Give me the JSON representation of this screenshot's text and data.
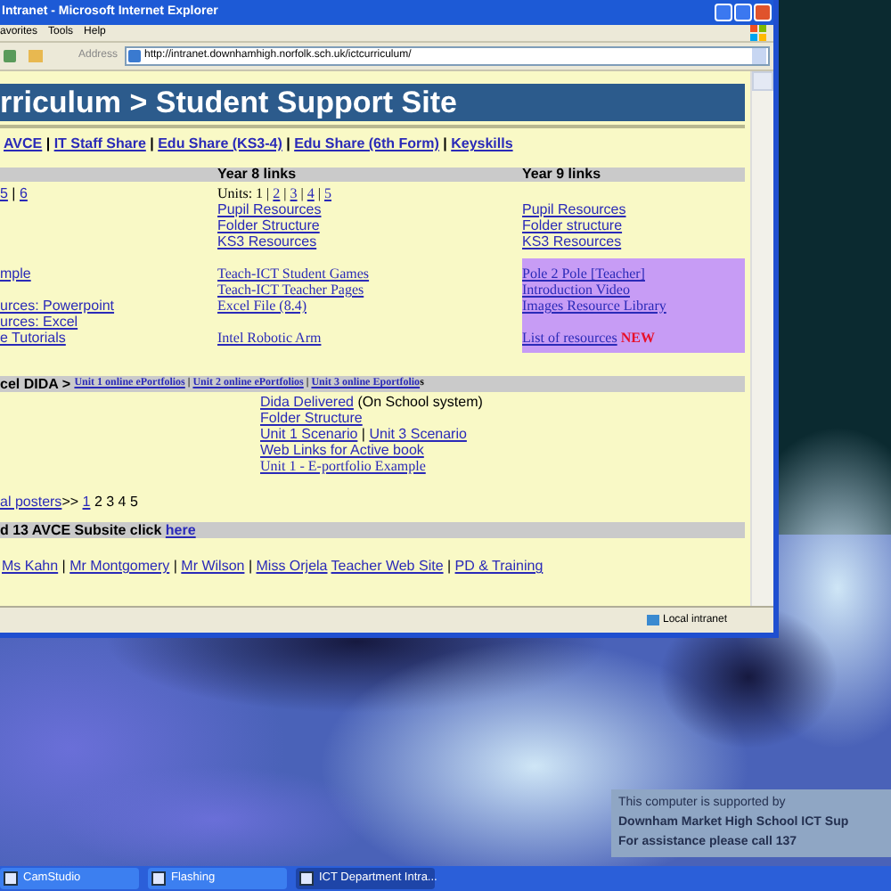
{
  "window": {
    "title": "Intranet - Microsoft Internet Explorer",
    "menu": [
      "avorites",
      "Tools",
      "Help"
    ],
    "address": {
      "label": "Address",
      "url": "http://intranet.downhamhigh.norfolk.sch.uk/ictcurriculum/"
    },
    "status_bar": "Local intranet"
  },
  "page": {
    "banner": "rriculum > Student Support Site",
    "nav": [
      {
        "kind": "link",
        "text": "AVCE"
      },
      {
        "kind": "text",
        "text": " | "
      },
      {
        "kind": "link",
        "text": "IT Staff Share"
      },
      {
        "kind": "text",
        "text": " | "
      },
      {
        "kind": "link",
        "text": "Edu Share (KS3-4)"
      },
      {
        "kind": "text",
        "text": " | "
      },
      {
        "kind": "link",
        "text": "Edu Share (6th Form)"
      },
      {
        "kind": "text",
        "text": " | "
      },
      {
        "kind": "link",
        "text": "Keyskills"
      }
    ],
    "year_links": {
      "headers": [
        "Year 8 links",
        "Year 9 links"
      ],
      "blocks": [
        {
          "highlight": false,
          "rows": [
            {
              "column_1": [
                {
                  "kind": "link",
                  "text": "5"
                },
                {
                  "kind": "text",
                  "text": " | "
                },
                {
                  "kind": "link",
                  "text": "6"
                }
              ],
              "year_8": [
                {
                  "kind": "serif-text",
                  "text": "Units: 1 | "
                },
                {
                  "kind": "serif-link",
                  "text": "2"
                },
                {
                  "kind": "serif-text",
                  "text": " | "
                },
                {
                  "kind": "serif-link",
                  "text": "3"
                },
                {
                  "kind": "serif-text",
                  "text": " | "
                },
                {
                  "kind": "serif-link",
                  "text": "4"
                },
                {
                  "kind": "serif-text",
                  "text": " | "
                },
                {
                  "kind": "serif-link",
                  "text": "5"
                }
              ]
            },
            {
              "year_8": [
                {
                  "kind": "link",
                  "text": "Pupil Resources"
                }
              ],
              "year_9": [
                {
                  "kind": "link",
                  "text": "Pupil Resources"
                }
              ]
            },
            {
              "year_8": [
                {
                  "kind": "link",
                  "text": "Folder Structure"
                }
              ],
              "year_9": [
                {
                  "kind": "link",
                  "text": "Folder structure"
                }
              ]
            },
            {
              "year_8": [
                {
                  "kind": "link",
                  "text": "KS3 Resources"
                }
              ],
              "year_9": [
                {
                  "kind": "link",
                  "text": "KS3 Resources"
                }
              ]
            }
          ]
        },
        {
          "highlight": true,
          "rows": [
            {
              "column_1": [
                {
                  "kind": "link",
                  "text": "mple"
                }
              ],
              "year_8": [
                {
                  "kind": "serif-link",
                  "text": "Teach-ICT Student Games"
                }
              ],
              "year_9": [
                {
                  "kind": "serif-link",
                  "text": "Pole 2 Pole [Teacher]"
                }
              ]
            },
            {
              "year_8": [
                {
                  "kind": "serif-link",
                  "text": "Teach-ICT Teacher Pages"
                }
              ],
              "year_9": [
                {
                  "kind": "serif-link",
                  "text": "Introduction Video"
                }
              ]
            },
            {
              "column_1": [
                {
                  "kind": "link",
                  "text": "urces: Powerpoint"
                }
              ],
              "year_8": [
                {
                  "kind": "serif-link",
                  "text": "Excel File (8.4)"
                }
              ],
              "year_9": [
                {
                  "kind": "serif-link",
                  "text": "Images Resource Library"
                }
              ]
            },
            {
              "column_1": [
                {
                  "kind": "link",
                  "text": "urces: Excel"
                }
              ]
            },
            {
              "column_1": [
                {
                  "kind": "link",
                  "text": "e Tutorials"
                }
              ],
              "year_8": [
                {
                  "kind": "serif-link",
                  "text": "Intel Robotic Arm"
                }
              ],
              "year_9": [
                {
                  "kind": "serif-link",
                  "text": "List of resources"
                },
                {
                  "kind": "new",
                  "text": "NEW"
                }
              ]
            }
          ]
        }
      ]
    },
    "dida": {
      "header": [
        {
          "kind": "text",
          "text": "cel DIDA > "
        },
        {
          "kind": "small-link",
          "text": "Unit 1 online ePortfolios"
        },
        {
          "kind": "small-text",
          "text": " | "
        },
        {
          "kind": "small-link",
          "text": "Unit 2 online ePortfolios"
        },
        {
          "kind": "small-text",
          "text": " | "
        },
        {
          "kind": "small-link",
          "text": "Unit 3 online Eportfolio"
        },
        {
          "kind": "small-text",
          "text": "s"
        }
      ],
      "lines": [
        [
          {
            "kind": "link",
            "text": "Dida Delivered"
          },
          {
            "kind": "text",
            "text": " (On School system)"
          }
        ],
        [
          {
            "kind": "link",
            "text": "Folder Structure"
          }
        ],
        [
          {
            "kind": "link",
            "text": "Unit 1 Scenario"
          },
          {
            "kind": "text",
            "text": " | "
          },
          {
            "kind": "link",
            "text": "Unit 3 Scenario"
          }
        ],
        [
          {
            "kind": "link",
            "text": "Web Links for Active book"
          }
        ],
        [
          {
            "kind": "serif-link",
            "text": "Unit 1 - E-portfolio Example"
          }
        ]
      ]
    },
    "posters": [
      {
        "kind": "link",
        "text": "al posters"
      },
      {
        "kind": "text",
        "text": ">> "
      },
      {
        "kind": "link",
        "text": "1"
      },
      {
        "kind": "text",
        "text": " 2 3 4 5"
      }
    ],
    "avce": [
      {
        "kind": "text",
        "text": "d 13 AVCE Subsite click "
      },
      {
        "kind": "link",
        "text": "here"
      }
    ],
    "staff": [
      {
        "kind": "link",
        "text": "Ms Kahn"
      },
      {
        "kind": "text",
        "text": " | "
      },
      {
        "kind": "link",
        "text": "Mr Montgomery"
      },
      {
        "kind": "text",
        "text": " | "
      },
      {
        "kind": "link",
        "text": "Mr Wilson"
      },
      {
        "kind": "text",
        "text": " | "
      },
      {
        "kind": "link",
        "text": "Miss Orjela"
      },
      {
        "kind": "spaced-link",
        "text": "Teacher Web Site"
      },
      {
        "kind": "text",
        "text": " | "
      },
      {
        "kind": "link",
        "text": "PD & Training"
      }
    ]
  },
  "desktop": {
    "notice": [
      "This computer is supported by",
      "Downham Market High School ICT Sup",
      "For assistance please call 137"
    ],
    "taskbar": [
      {
        "label": "CamStudio",
        "selected": false
      },
      {
        "label": "Flashing",
        "selected": false
      },
      {
        "label": "ICT Department Intra...",
        "selected": true
      }
    ]
  }
}
